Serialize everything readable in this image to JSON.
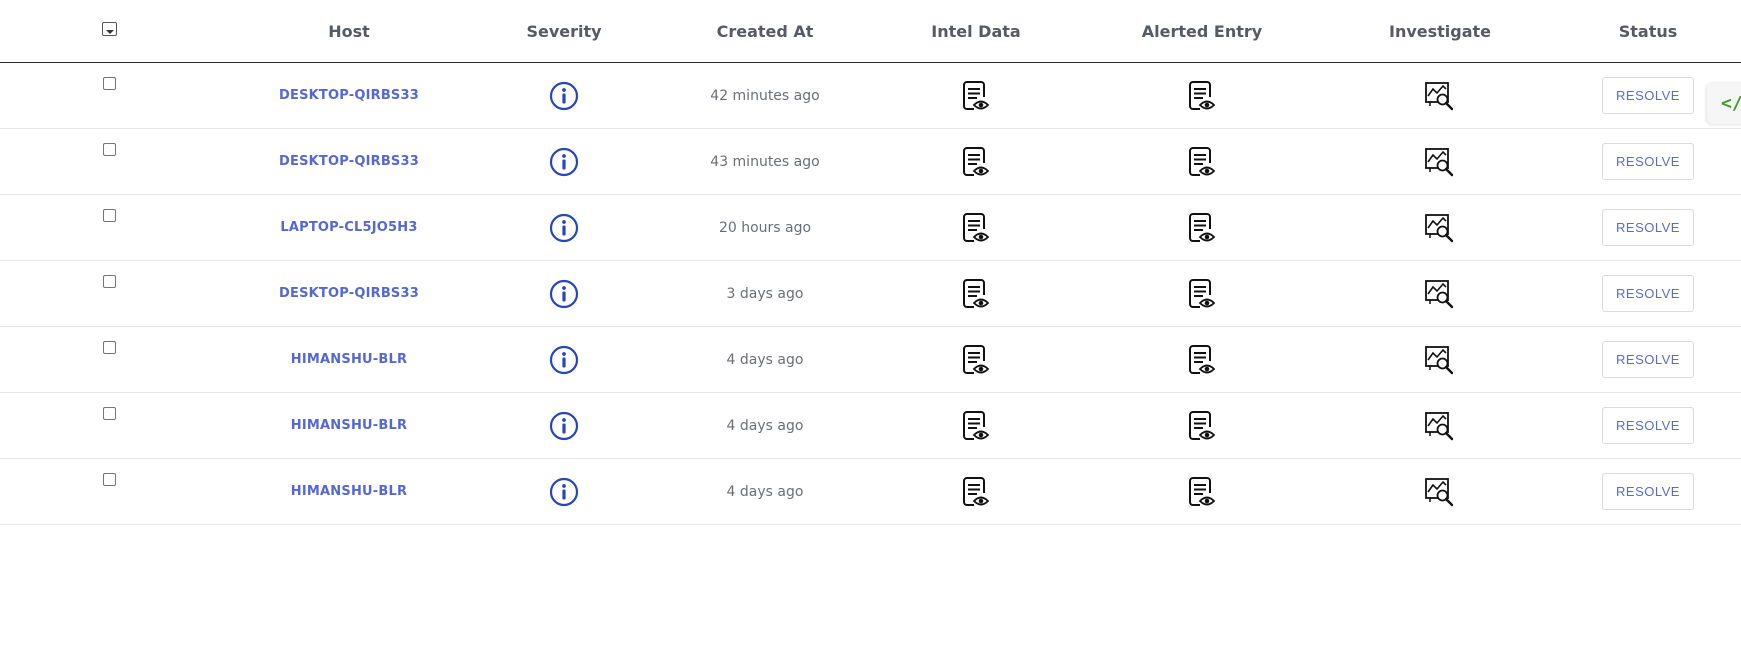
{
  "table": {
    "headers": {
      "host": "Host",
      "severity": "Severity",
      "created_at": "Created At",
      "intel_data": "Intel Data",
      "alerted_entry": "Alerted Entry",
      "investigate": "Investigate",
      "status": "Status"
    },
    "rows": [
      {
        "host": "DESKTOP-QIRBS33",
        "created_at": "42 minutes ago",
        "status_button": "RESOLVE",
        "checked": false
      },
      {
        "host": "DESKTOP-QIRBS33",
        "created_at": "43 minutes ago",
        "status_button": "RESOLVE",
        "checked": false
      },
      {
        "host": "LAPTOP-CL5JO5H3",
        "created_at": "20 hours ago",
        "status_button": "RESOLVE",
        "checked": false
      },
      {
        "host": "DESKTOP-QIRBS33",
        "created_at": "3 days ago",
        "status_button": "RESOLVE",
        "checked": false
      },
      {
        "host": "HIMANSHU-BLR",
        "created_at": "4 days ago",
        "status_button": "RESOLVE",
        "checked": false
      },
      {
        "host": "HIMANSHU-BLR",
        "created_at": "4 days ago",
        "status_button": "RESOLVE",
        "checked": false
      },
      {
        "host": "HIMANSHU-BLR",
        "created_at": "4 days ago",
        "status_button": "RESOLVE",
        "checked": false
      }
    ],
    "icons": {
      "select_all": "select-all-dropdown-icon",
      "severity": "info-circle-icon",
      "intel_data": "document-eye-icon",
      "alerted_entry": "document-eye-icon",
      "investigate": "chart-magnifier-icon"
    }
  },
  "side_tab": {
    "label": "</",
    "icon": "code-icon"
  },
  "colors": {
    "host_link": "#5568d1",
    "severity_icon": "#2747b8",
    "header_text": "#555a64",
    "muted_text": "#6b6e76",
    "resolve_text": "#5b6bc8",
    "side_tab_accent": "#3f9a1f"
  }
}
